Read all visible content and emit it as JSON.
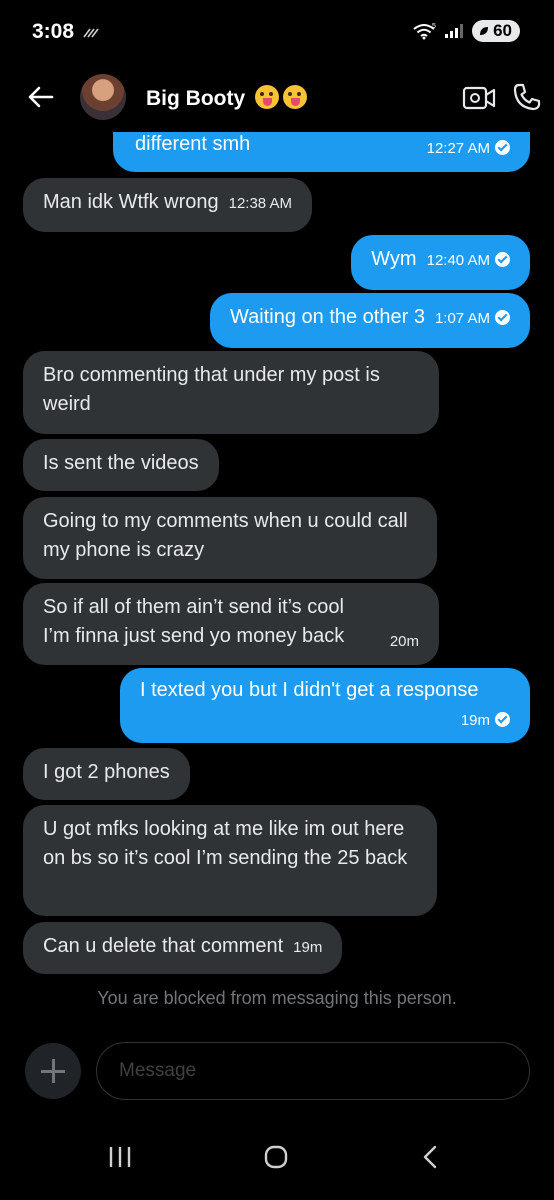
{
  "status_bar": {
    "time": "3:08",
    "battery": "60",
    "network": "5"
  },
  "header": {
    "contact_name": "Big Booty"
  },
  "messages": [
    {
      "from": "me",
      "text": "different smh",
      "time": "12:27 AM"
    },
    {
      "from": "them",
      "text": "Man idk Wtfk wrong",
      "time": "12:38 AM"
    },
    {
      "from": "me",
      "text": "Wym",
      "time": "12:40 AM"
    },
    {
      "from": "me",
      "text": "Waiting on the other 3",
      "time": "1:07 AM"
    },
    {
      "from": "them",
      "text": "Bro commenting that under my post is weird"
    },
    {
      "from": "them",
      "text": "Is sent the videos"
    },
    {
      "from": "them",
      "text": "Going to my comments when u could call my phone is crazy"
    },
    {
      "from": "them",
      "text": "So if all of them ain’t send it’s cool I’m finna just send yo money back",
      "time": "20m"
    },
    {
      "from": "me",
      "text": "I texted you but I didn't get a response",
      "time": "19m"
    },
    {
      "from": "them",
      "text": "I got 2 phones"
    },
    {
      "from": "them",
      "text": "U got mfks looking at me like im out here on bs so it’s cool I’m sending the 25 back"
    },
    {
      "from": "them",
      "text": "Can u delete that comment",
      "time": "19m"
    }
  ],
  "blocked_notice": "You are blocked from messaging this person.",
  "composer": {
    "placeholder": "Message"
  },
  "colors": {
    "sent_bubble": "#1d9bf0",
    "received_bubble": "#2f3336",
    "background": "#000000"
  }
}
